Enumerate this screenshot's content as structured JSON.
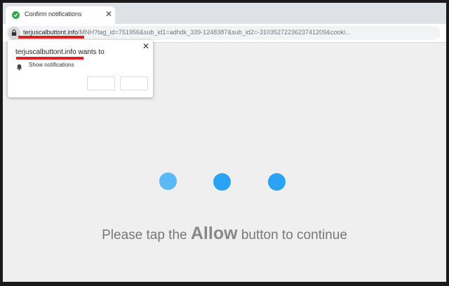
{
  "tab": {
    "title": "Confirm notifications",
    "close_glyph": "✕",
    "favicon": "check-circle-icon"
  },
  "address_bar": {
    "host": "terjuscalbuttont.info",
    "path": "/MNH?tag_id=751956&sub_id1=adhdk_339-1248387&sub_id2=-3103527223623741209&cooki..."
  },
  "popup": {
    "title": "terjuscalbuttont.info wants to",
    "permission_label": "Show notifications",
    "close_glyph": "✕",
    "redaction_color": "#e02020"
  },
  "page": {
    "dot_color": "#2ba3f5",
    "message_before": "Please tap the ",
    "message_bold": "Allow",
    "message_after": " button to continue"
  }
}
